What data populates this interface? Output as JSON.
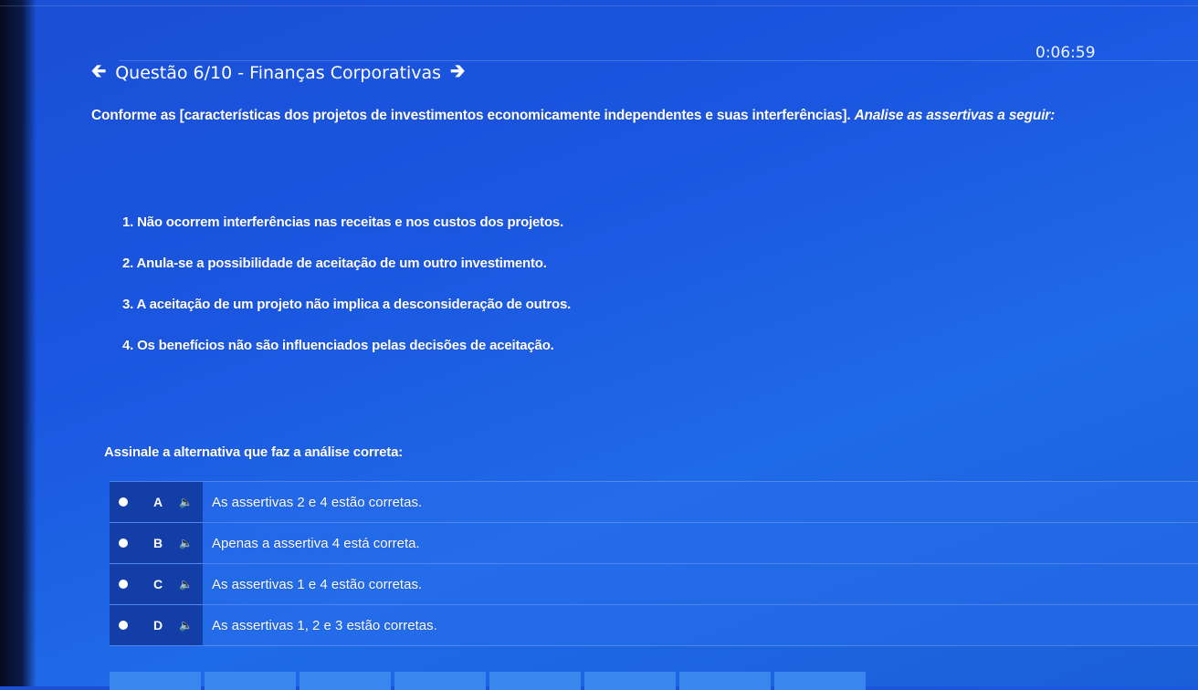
{
  "timer": "0:06:59",
  "header": {
    "prev_icon": "arrow-left-icon",
    "title": "Questão 6/10 - Finanças Corporativas",
    "next_icon": "arrow-right-icon"
  },
  "prompt": {
    "text": "Conforme as [características dos projetos de investimentos economicamente independentes e suas interferências].",
    "emphasis": "Analise as assertivas a seguir:"
  },
  "assertions": [
    "1. Não ocorrem interferências nas receitas e nos custos dos projetos.",
    "2. Anula-se a possibilidade de aceitação de um outro investimento.",
    "3. A aceitação de um projeto não implica a desconsideração de outros.",
    "4. Os benefícios não são influenciados pelas decisões de aceitação."
  ],
  "instruction": "Assinale a alternativa que faz a análise correta:",
  "options": [
    {
      "letter": "A",
      "text": "As assertivas 2 e 4 estão corretas."
    },
    {
      "letter": "B",
      "text": "Apenas a assertiva 4 está correta."
    },
    {
      "letter": "C",
      "text": "As assertivas 1 e 4 estão corretas."
    },
    {
      "letter": "D",
      "text": "As assertivas 1, 2 e 3 estão corretas."
    }
  ],
  "icons": {
    "speaker": "speaker-icon",
    "radio": "radio-button"
  },
  "colors": {
    "background": "#1a56e0",
    "option_left": "#133ea8",
    "tab": "#3a86ef"
  }
}
